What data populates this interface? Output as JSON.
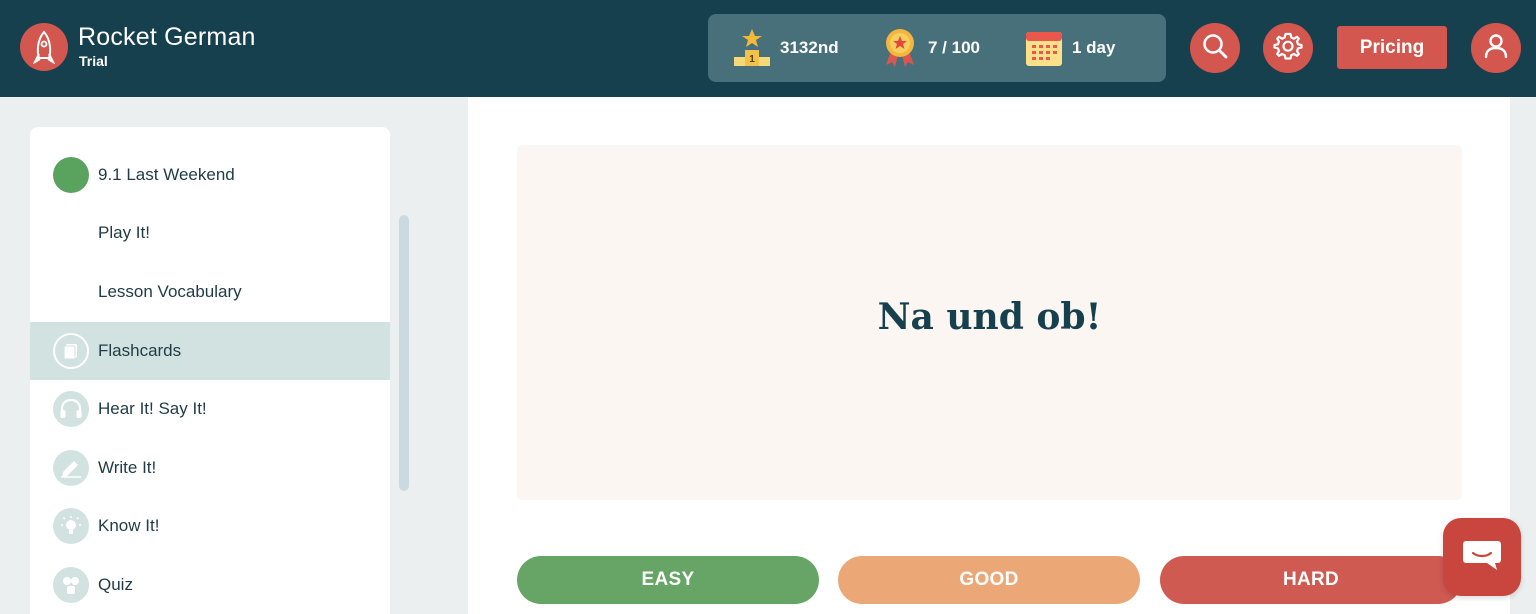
{
  "brand": {
    "title": "Rocket German",
    "subtitle": "Trial"
  },
  "stats": {
    "rank": {
      "value": "3132nd",
      "icon": "podium-icon"
    },
    "points": {
      "value": "7 / 100",
      "icon": "medal-icon"
    },
    "streak": {
      "value": "1 day",
      "icon": "calendar-icon"
    }
  },
  "header_actions": {
    "pricing_label": "Pricing",
    "search_icon": "search-icon",
    "settings_icon": "gear-icon",
    "profile_icon": "user-icon"
  },
  "sidebar": {
    "items": [
      {
        "label": "9.1 Last Weekend",
        "icon": "complete-dot"
      },
      {
        "label": "Play It!",
        "icon": ""
      },
      {
        "label": "Lesson Vocabulary",
        "icon": ""
      },
      {
        "label": "Flashcards",
        "icon": "flashcards-icon",
        "active": true
      },
      {
        "label": "Hear It! Say It!",
        "icon": "headphones-icon"
      },
      {
        "label": "Write It!",
        "icon": "pencil-icon"
      },
      {
        "label": "Know It!",
        "icon": "lightbulb-icon"
      },
      {
        "label": "Quiz",
        "icon": "quiz-icon"
      }
    ]
  },
  "flashcard": {
    "text": "Na und ob!"
  },
  "rating": {
    "easy": "EASY",
    "good": "GOOD",
    "hard": "HARD"
  },
  "colors": {
    "header": "#17404f",
    "accent": "#d4574f",
    "easy": "#66a566",
    "good": "#eca777",
    "hard": "#cf5a52",
    "complete": "#5aa35e"
  }
}
